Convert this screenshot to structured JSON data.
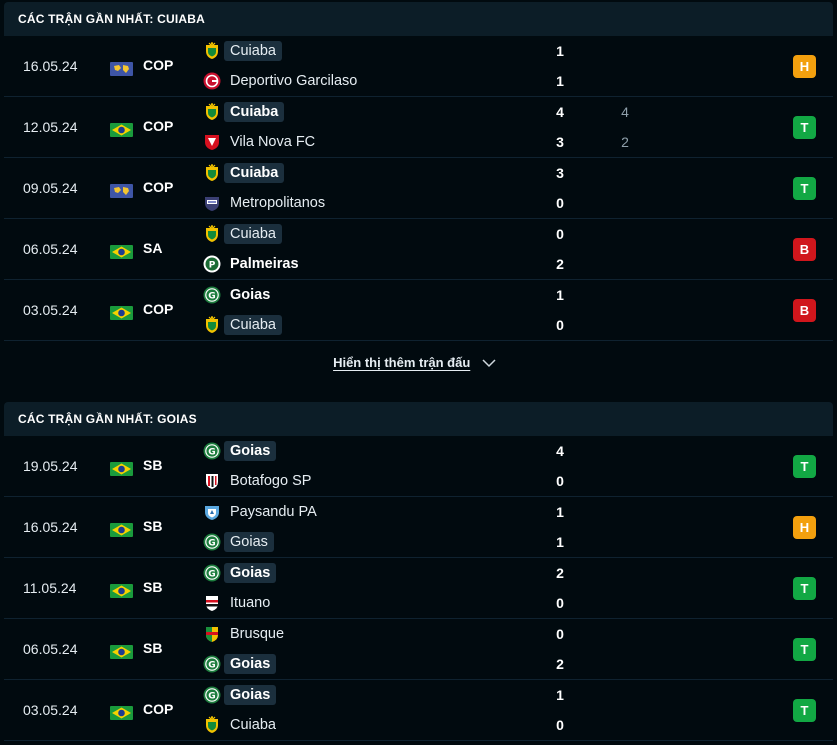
{
  "sections": [
    {
      "title": "CÁC TRẬN GẦN NHẤT: CUIABA",
      "matches": [
        {
          "date": "16.05.24",
          "flag": "world",
          "league": "COP",
          "home": {
            "name": "Cuiaba",
            "crest": "cuiaba",
            "highlight": true,
            "bold": false
          },
          "away": {
            "name": "Deportivo Garcilaso",
            "crest": "garcilaso",
            "highlight": false,
            "bold": false
          },
          "score_home": "1",
          "score_away": "1",
          "pen_home": "",
          "pen_away": "",
          "result": "H"
        },
        {
          "date": "12.05.24",
          "flag": "brazil",
          "league": "COP",
          "home": {
            "name": "Cuiaba",
            "crest": "cuiaba",
            "highlight": true,
            "bold": true
          },
          "away": {
            "name": "Vila Nova FC",
            "crest": "vilanova",
            "highlight": false,
            "bold": false
          },
          "score_home": "4",
          "score_away": "3",
          "pen_home": "4",
          "pen_away": "2",
          "result": "T"
        },
        {
          "date": "09.05.24",
          "flag": "world",
          "league": "COP",
          "home": {
            "name": "Cuiaba",
            "crest": "cuiaba",
            "highlight": true,
            "bold": true
          },
          "away": {
            "name": "Metropolitanos",
            "crest": "metropolitanos",
            "highlight": false,
            "bold": false
          },
          "score_home": "3",
          "score_away": "0",
          "pen_home": "",
          "pen_away": "",
          "result": "T"
        },
        {
          "date": "06.05.24",
          "flag": "brazil",
          "league": "SA",
          "home": {
            "name": "Cuiaba",
            "crest": "cuiaba",
            "highlight": true,
            "bold": false
          },
          "away": {
            "name": "Palmeiras",
            "crest": "palmeiras",
            "highlight": false,
            "bold": true
          },
          "score_home": "0",
          "score_away": "2",
          "pen_home": "",
          "pen_away": "",
          "result": "B"
        },
        {
          "date": "03.05.24",
          "flag": "brazil",
          "league": "COP",
          "home": {
            "name": "Goias",
            "crest": "goias",
            "highlight": false,
            "bold": true
          },
          "away": {
            "name": "Cuiaba",
            "crest": "cuiaba",
            "highlight": true,
            "bold": false
          },
          "score_home": "1",
          "score_away": "0",
          "pen_home": "",
          "pen_away": "",
          "result": "B"
        }
      ]
    },
    {
      "title": "CÁC TRẬN GẦN NHẤT: GOIAS",
      "matches": [
        {
          "date": "19.05.24",
          "flag": "brazil",
          "league": "SB",
          "home": {
            "name": "Goias",
            "crest": "goias",
            "highlight": true,
            "bold": true
          },
          "away": {
            "name": "Botafogo SP",
            "crest": "botafogo",
            "highlight": false,
            "bold": false
          },
          "score_home": "4",
          "score_away": "0",
          "pen_home": "",
          "pen_away": "",
          "result": "T"
        },
        {
          "date": "16.05.24",
          "flag": "brazil",
          "league": "SB",
          "home": {
            "name": "Paysandu PA",
            "crest": "paysandu",
            "highlight": false,
            "bold": false
          },
          "away": {
            "name": "Goias",
            "crest": "goias",
            "highlight": true,
            "bold": false
          },
          "score_home": "1",
          "score_away": "1",
          "pen_home": "",
          "pen_away": "",
          "result": "H"
        },
        {
          "date": "11.05.24",
          "flag": "brazil",
          "league": "SB",
          "home": {
            "name": "Goias",
            "crest": "goias",
            "highlight": true,
            "bold": true
          },
          "away": {
            "name": "Ituano",
            "crest": "ituano",
            "highlight": false,
            "bold": false
          },
          "score_home": "2",
          "score_away": "0",
          "pen_home": "",
          "pen_away": "",
          "result": "T"
        },
        {
          "date": "06.05.24",
          "flag": "brazil",
          "league": "SB",
          "home": {
            "name": "Brusque",
            "crest": "brusque",
            "highlight": false,
            "bold": false
          },
          "away": {
            "name": "Goias",
            "crest": "goias",
            "highlight": true,
            "bold": true
          },
          "score_home": "0",
          "score_away": "2",
          "pen_home": "",
          "pen_away": "",
          "result": "T"
        },
        {
          "date": "03.05.24",
          "flag": "brazil",
          "league": "COP",
          "home": {
            "name": "Goias",
            "crest": "goias",
            "highlight": true,
            "bold": true
          },
          "away": {
            "name": "Cuiaba",
            "crest": "cuiaba",
            "highlight": false,
            "bold": false
          },
          "score_home": "1",
          "score_away": "0",
          "pen_home": "",
          "pen_away": "",
          "result": "T"
        }
      ]
    }
  ],
  "show_more": {
    "label": "Hiển thị thêm trận đấu",
    "icon": "chevron-down-icon"
  },
  "colors": {
    "draw": "#f3a00e",
    "win": "#12a844",
    "loss": "#d0161c",
    "header_bg": "#0c1d27",
    "page_bg": "#010a0f"
  }
}
